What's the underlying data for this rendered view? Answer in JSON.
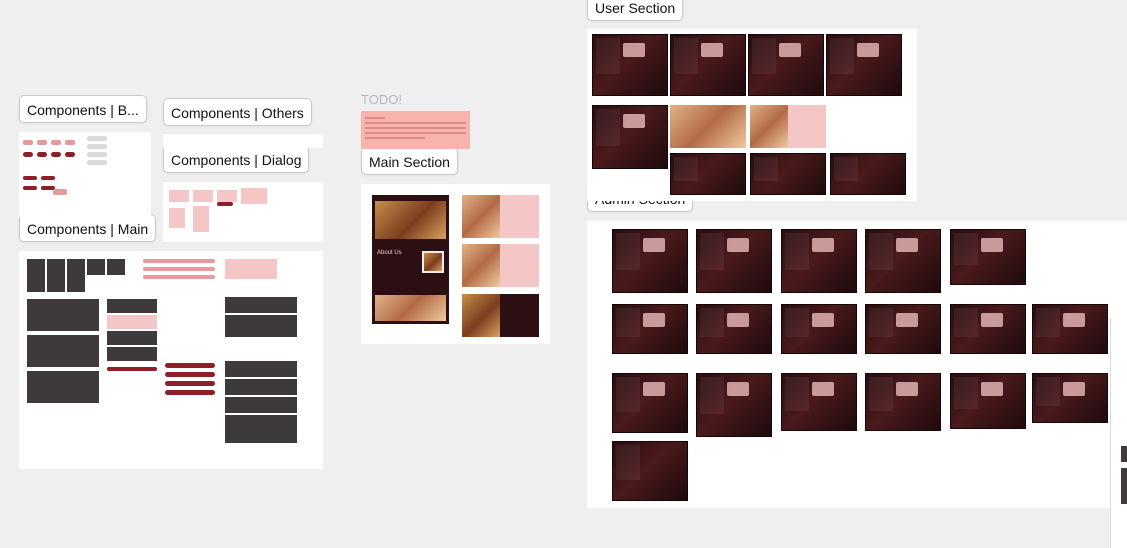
{
  "sections": {
    "components_basic": "Components | B...",
    "components_others": "Components | Others",
    "components_dialog": "Components | Dialog",
    "components_main": "Components | Main",
    "main_section": "Main Section",
    "user_section": "User Section",
    "admin_section": "Admin Section"
  },
  "todo": {
    "title": "TODO!"
  },
  "main_preview": {
    "about_heading": "About Us"
  },
  "colors": {
    "canvas": "#efefef",
    "frame": "#ffffff",
    "dark_panel": "#3e3a3b",
    "maroon": "#2b0f12",
    "accent_pink": "#f4c6c6",
    "accent_red": "#8c1f28",
    "todo_note": "#f8b3ae"
  }
}
